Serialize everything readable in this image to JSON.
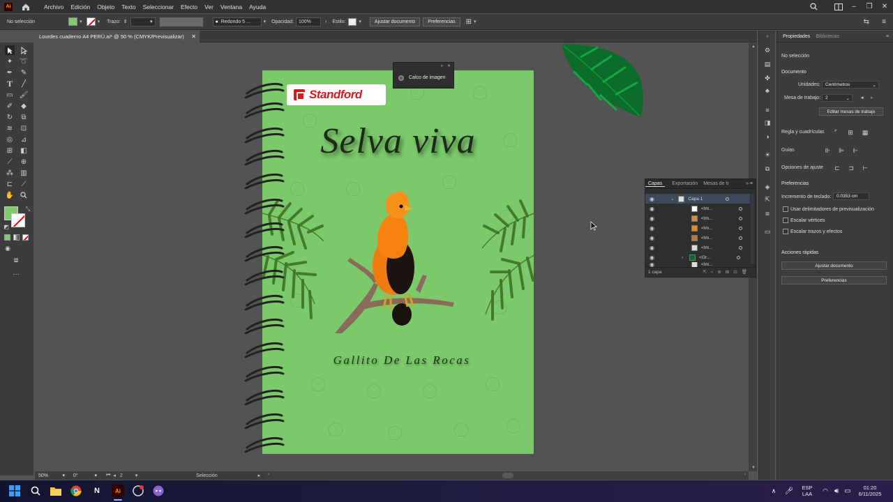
{
  "app": {
    "logo": "Ai"
  },
  "menu": [
    "Archivo",
    "Edición",
    "Objeto",
    "Texto",
    "Seleccionar",
    "Efecto",
    "Ver",
    "Ventana",
    "Ayuda"
  ],
  "controlbar": {
    "selection": "No selección",
    "stroke_label": "Trazo:",
    "brush": "Redondo 5 ...",
    "opacity_label": "Opacidad:",
    "opacity_value": "100%",
    "style_label": "Estilo:",
    "adjust_btn": "Ajustar documento",
    "prefs_btn": "Preferencias"
  },
  "document_tab": {
    "title": "Lourdes cuaderno A4 PERÚ.ai* @ 50 % (CMYK/Previsualizar)"
  },
  "artwork": {
    "brand": "Standford",
    "title": "Selva viva",
    "subtitle": "Gallito De Las Rocas"
  },
  "calco_panel": {
    "label": "Calco de imagen"
  },
  "layers_panel": {
    "tabs": [
      "Capas",
      "Exportación",
      "Mesas de tr"
    ],
    "rows": [
      "Capa 1",
      "<Im...",
      "<Im...",
      "<Im...",
      "<Im...",
      "<Im...",
      "<Gr...",
      "<Im..."
    ],
    "footer": "1 capa"
  },
  "status": {
    "zoom": "50%",
    "rotation": "0°",
    "artboard": "2",
    "tool": "Selección"
  },
  "properties": {
    "tabs": [
      "Propiedades",
      "Bibliotecas"
    ],
    "no_selection": "No selección",
    "document_title": "Documento",
    "units_label": "Unidades:",
    "units_value": "Centímetros",
    "artboard_label": "Mesa de trabajo:",
    "artboard_value": "2",
    "edit_artboards": "Editar mesas de trabajo",
    "rulers_label": "Regla y cuadrículas",
    "guides_label": "Guías",
    "snap_label": "Opciones de ajuste",
    "prefs_title": "Preferencias",
    "keyboard_inc_label": "Incremento de teclado:",
    "keyboard_inc_value": "0.0353 cm",
    "cb_preview_bounds": "Usar delimitadores de previsualización",
    "cb_scale_corners": "Escalar vértices",
    "cb_scale_strokes": "Escalar trazos y efectos",
    "quick_actions": "Acciones rápidas",
    "btn_adjust": "Ajustar documento",
    "btn_prefs": "Preferencias"
  },
  "taskbar": {
    "lang": "ESP",
    "layout": "LAA",
    "time": "01:20",
    "date": "6/11/2025"
  },
  "colors": {
    "artboard": "#7bc96b",
    "fill_swatch": "#7dcb6b",
    "brand_red": "#d7181f"
  }
}
